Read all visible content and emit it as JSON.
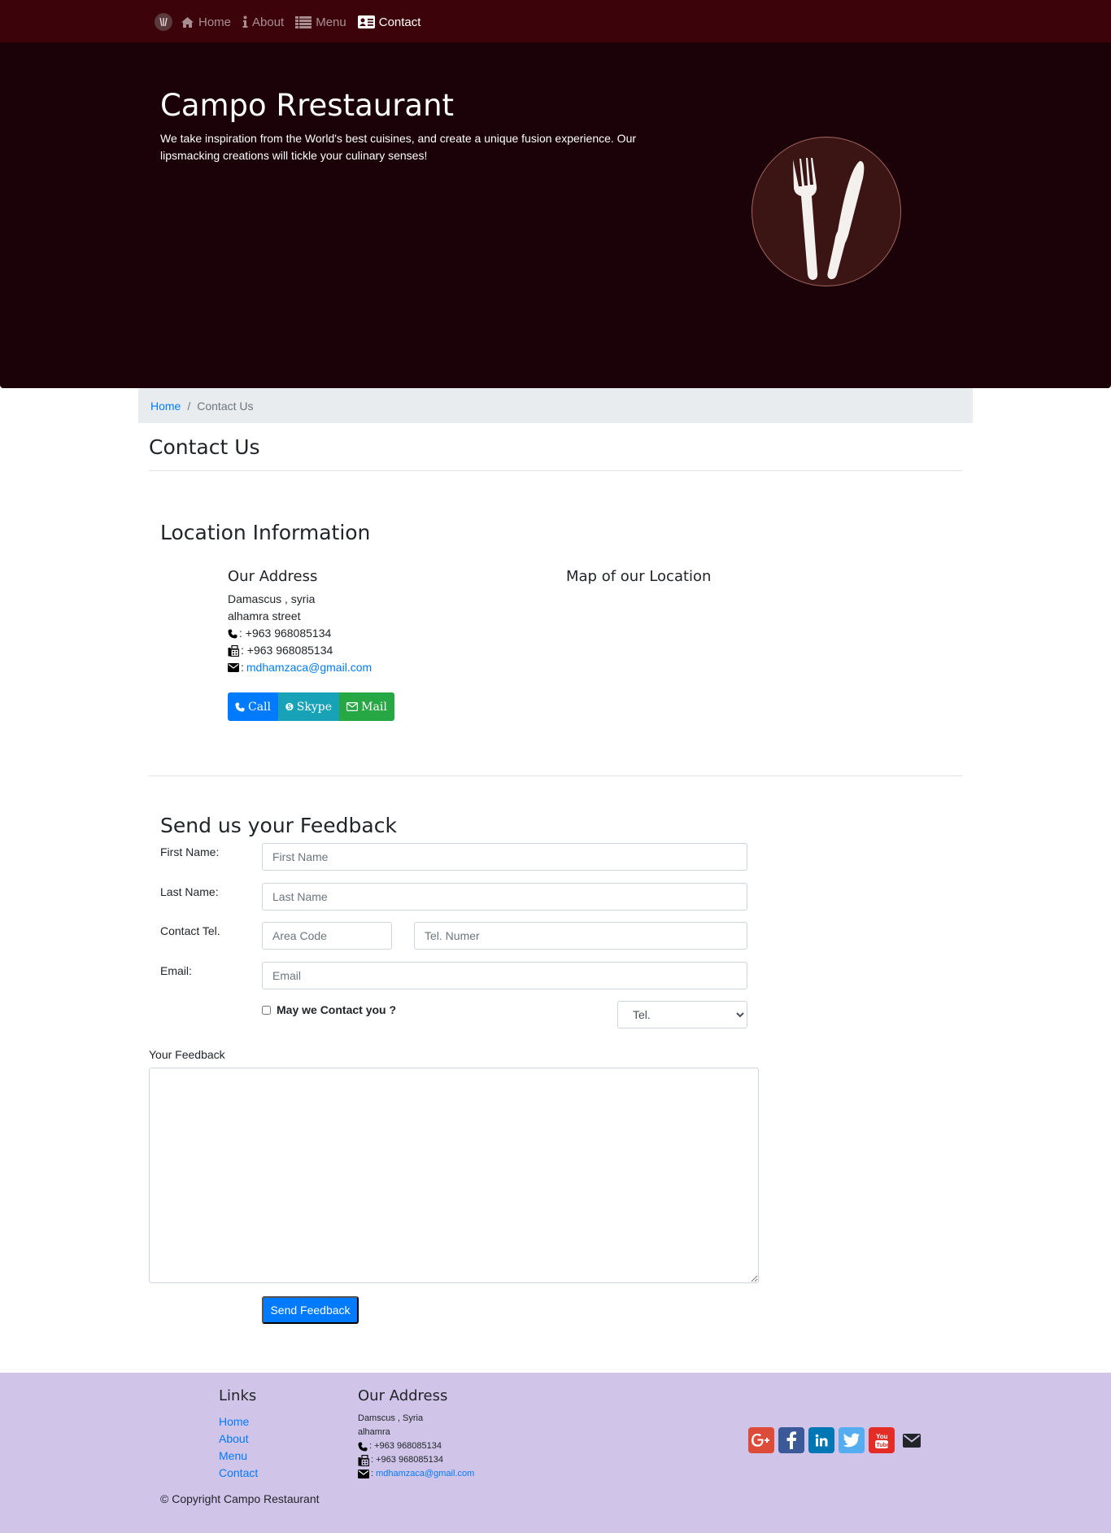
{
  "nav": {
    "items": [
      {
        "label": "Home",
        "icon": "home-icon"
      },
      {
        "label": "About",
        "icon": "info-icon"
      },
      {
        "label": "Menu",
        "icon": "list-icon"
      },
      {
        "label": "Contact",
        "icon": "address-card-icon",
        "active": true
      }
    ]
  },
  "hero": {
    "title": "Campo Rrestaurant",
    "text": "We take inspiration from the World's best cuisines, and create a unique fusion experience. Our lipsmacking creations will tickle your culinary senses!"
  },
  "breadcrumb": {
    "home": "Home",
    "separator": "/",
    "current": "Contact Us"
  },
  "page_title": "Contact Us",
  "location": {
    "heading": "Location Information",
    "address_heading": "Our Address",
    "map_heading": "Map of our Location",
    "line1": "Damascus , syria",
    "line2": "alhamra street",
    "phone": ": +963 968085134",
    "fax": ": +963 968085134",
    "email_prefix": ":",
    "email": "mdhamzaca@gmail.com"
  },
  "buttons": {
    "call": "Call",
    "skype": "Skype",
    "mail": "Mail"
  },
  "feedback": {
    "heading": "Send us your Feedback",
    "first_name_label": "First Name:",
    "first_name_placeholder": "First Name",
    "last_name_label": "Last Name:",
    "last_name_placeholder": "Last Name",
    "tel_label": "Contact Tel.",
    "area_code_placeholder": "Area Code",
    "tel_placeholder": "Tel. Numer",
    "email_label": "Email:",
    "email_placeholder": "Email",
    "contact_checkbox": "May we Contact you ?",
    "contact_method": "Tel.",
    "feedback_label": "Your Feedback",
    "submit": "Send Feedback"
  },
  "footer": {
    "links_heading": "Links",
    "links": [
      "Home",
      "About",
      "Menu",
      "Contact"
    ],
    "address_heading": "Our Address",
    "line1": "Damscus , Syria",
    "line2": "alhamra",
    "phone": ": +963 968085134",
    "fax": ": +963 968085134",
    "email_prefix": ":",
    "email": "mdhamzaca@gmail.com",
    "copyright": "© Copyright Campo Restaurant",
    "socials": [
      {
        "name": "google-plus-icon",
        "color": "#dd4b39"
      },
      {
        "name": "facebook-icon",
        "color": "#3b5998"
      },
      {
        "name": "linkedin-icon",
        "color": "#0077b5"
      },
      {
        "name": "twitter-icon",
        "color": "#55acee"
      },
      {
        "name": "youtube-icon",
        "color": "#e52d27"
      },
      {
        "name": "envelope-icon",
        "color": "#212529"
      }
    ]
  },
  "colors": {
    "navbar": "#3d030a",
    "hero": "#1a0208",
    "footer": "#d1c4e9",
    "primary": "#007bff"
  }
}
